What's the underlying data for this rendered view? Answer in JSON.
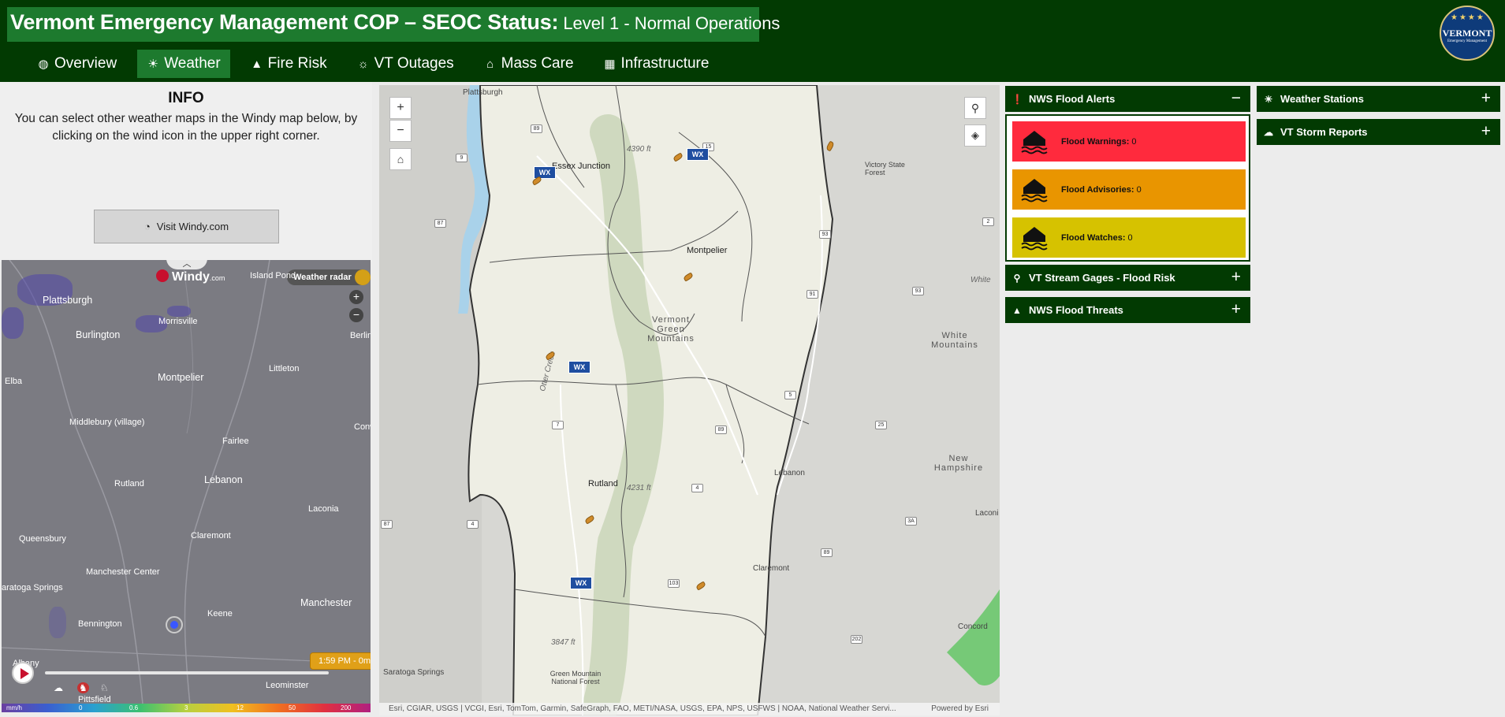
{
  "header": {
    "title": "Vermont Emergency Management COP – SEOC Status:",
    "status": "Level 1 - Normal Operations",
    "logo_text": "VERMONT",
    "logo_subtext": "Emergency Management"
  },
  "nav": {
    "items": [
      {
        "label": "Overview",
        "icon": "globe-icon"
      },
      {
        "label": "Weather",
        "icon": "sun-icon",
        "active": true
      },
      {
        "label": "Fire Risk",
        "icon": "warning-icon"
      },
      {
        "label": "VT Outages",
        "icon": "lightbulb-icon"
      },
      {
        "label": "Mass Care",
        "icon": "house-icon"
      },
      {
        "label": "Infrastructure",
        "icon": "building-icon"
      }
    ]
  },
  "info": {
    "title": "INFO",
    "text": "You can select other weather maps in the Windy map below, by clicking on the wind icon in the upper right corner.",
    "button": "Visit Windy.com"
  },
  "windy": {
    "brand": "Windy",
    "brand_suffix": ".com",
    "layer": "Weather radar",
    "time": "1:59 PM - 0m",
    "unit": "mm/h",
    "scale": [
      "0",
      "0.6",
      "3",
      "12",
      "50",
      "200"
    ],
    "labels": {
      "plattsburgh": "Plattsburgh",
      "island_pond": "Island Pond",
      "morrisville": "Morrisville",
      "burlington": "Burlington",
      "berlin": "Berlin",
      "littleton": "Littleton",
      "elba": "Elba",
      "montpelier": "Montpelier",
      "middlebury": "Middlebury (village)",
      "conw": "Conw",
      "fairlee": "Fairlee",
      "rutland": "Rutland",
      "lebanon": "Lebanon",
      "laconia": "Laconia",
      "queensbury": "Queensbury",
      "claremont": "Claremont",
      "manchester_center": "Manchester Center",
      "saratoga": "aratoga Springs",
      "manchester": "Manchester",
      "keene": "Keene",
      "bennington": "Bennington",
      "albany": "Albany",
      "pittsfield": "Pittsfield",
      "leominster": "Leominster"
    }
  },
  "map": {
    "labels": {
      "plattsburgh": "Plattsburgh",
      "essex": "Essex Junction",
      "montpelier": "Montpelier",
      "victory": "Victory State Forest",
      "vermont_green": "Vermont Green Mountains",
      "rutland": "Rutland",
      "lebanon": "Lebanon",
      "new_hampshire": "New Hampshire",
      "white_mountains": "White Mountains",
      "white": "White",
      "claremont": "Claremont",
      "concord": "Concord",
      "laconi": "Laconi",
      "saratoga": "Saratoga Springs",
      "gm_nf": "Green Mountain National Forest",
      "otter_creek": "Otter Creek",
      "h4390": "4390 ft",
      "h4231": "4231 ft",
      "h3847": "3847 ft"
    },
    "shields": {
      "s89a": "89",
      "s9": "9",
      "s87a": "87",
      "s15": "15",
      "s2": "2",
      "s93a": "93",
      "s91": "91",
      "s93b": "93",
      "s5": "5",
      "s7": "7",
      "s89b": "89",
      "s25": "25",
      "s4a": "4",
      "s4b": "4",
      "s87b": "87",
      "s3a": "3A",
      "s103": "103",
      "s89c": "89",
      "s202": "202"
    },
    "wx": "WX",
    "attribution": "Esri, CGIAR, USGS | VCGI, Esri, TomTom, Garmin, SafeGraph, FAO, METI/NASA, USGS, EPA, NPS, USFWS | NOAA, National Weather Servi...",
    "powered": "Powered by Esri"
  },
  "flood": {
    "title": "NWS Flood Alerts",
    "alerts": [
      {
        "label": "Flood Warnings:",
        "count": "0",
        "color": "#ff2a3d"
      },
      {
        "label": "Flood Advisories:",
        "count": "0",
        "color": "#e99500"
      },
      {
        "label": "Flood Watches:",
        "count": "0",
        "color": "#d6c200"
      }
    ],
    "stream_gages": "VT Stream Gages - Flood Risk",
    "threats": "NWS Flood Threats"
  },
  "right": {
    "stations": "Weather Stations",
    "storm_reports": "VT Storm Reports"
  },
  "colors": {
    "header_bg": "#023a02",
    "accent": "#1d7a2e"
  }
}
